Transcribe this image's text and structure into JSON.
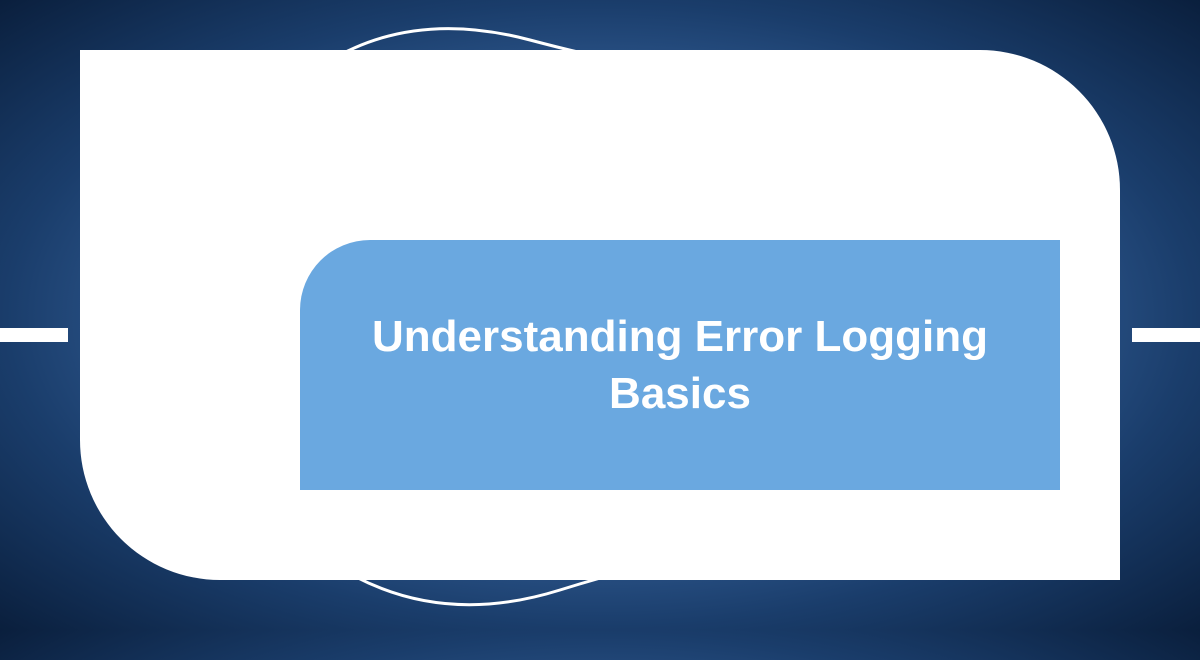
{
  "title": "Understanding Error Logging Basics",
  "colors": {
    "inner_bg": "#6aa8e0",
    "outer_bg": "#ffffff",
    "text": "#ffffff"
  }
}
